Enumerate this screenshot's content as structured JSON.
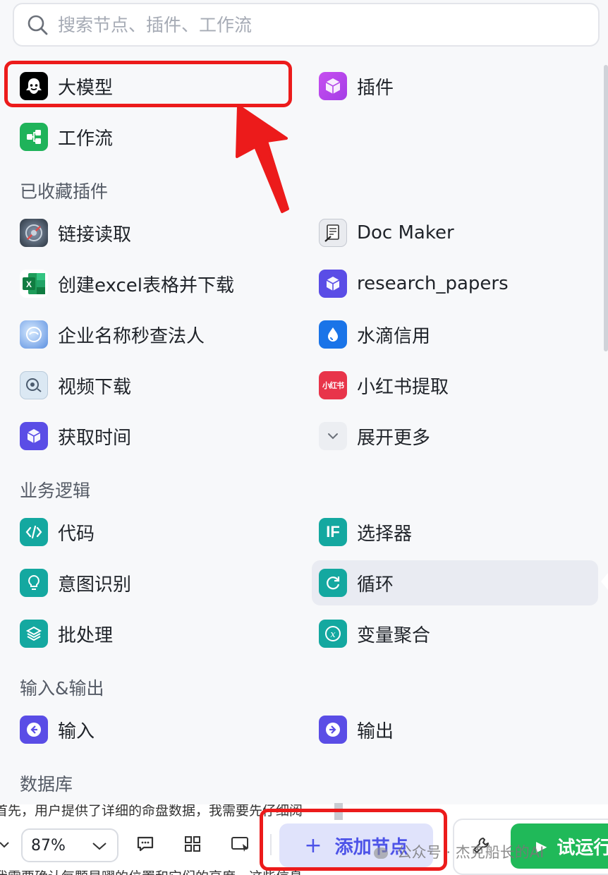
{
  "search": {
    "placeholder": "搜索节点、插件、工作流"
  },
  "top_items": [
    {
      "label": "大模型",
      "icon": "llm-icon"
    },
    {
      "label": "插件",
      "icon": "plugin-icon"
    },
    {
      "label": "工作流",
      "icon": "workflow-icon"
    }
  ],
  "sections": {
    "favorites": "已收藏插件",
    "logic": "业务逻辑",
    "io": "输入&输出",
    "database": "数据库"
  },
  "favorites": [
    {
      "label": "链接读取",
      "icon": "link-reader-icon"
    },
    {
      "label": "Doc Maker",
      "icon": "doc-maker-icon"
    },
    {
      "label": "创建excel表格并下载",
      "icon": "excel-icon"
    },
    {
      "label": "research_papers",
      "icon": "research-papers-icon"
    },
    {
      "label": "企业名称秒查法人",
      "icon": "enterprise-lookup-icon"
    },
    {
      "label": "水滴信用",
      "icon": "waterdrop-icon"
    },
    {
      "label": "视频下载",
      "icon": "video-download-icon"
    },
    {
      "label": "小红书提取",
      "icon": "xiaohongshu-icon",
      "icon_text": "小红书"
    },
    {
      "label": "获取时间",
      "icon": "time-icon"
    },
    {
      "label": "展开更多",
      "icon": "chevron-down-icon"
    }
  ],
  "logic": [
    {
      "label": "代码",
      "icon": "code-icon"
    },
    {
      "label": "选择器",
      "icon": "selector-icon",
      "icon_text": "IF"
    },
    {
      "label": "意图识别",
      "icon": "intent-icon"
    },
    {
      "label": "循环",
      "icon": "loop-icon"
    },
    {
      "label": "批处理",
      "icon": "batch-icon"
    },
    {
      "label": "变量聚合",
      "icon": "variable-merge-icon"
    }
  ],
  "io": [
    {
      "label": "输入",
      "icon": "input-icon"
    },
    {
      "label": "输出",
      "icon": "output-icon"
    }
  ],
  "background_text": {
    "line1": "首先，用户提供了详细的命盘数据，我需要先仔细阅",
    "line2": "我需要确认每颗星曜的位置和它们的亮度，这些信息"
  },
  "toolbar": {
    "zoom": "87%",
    "add_node": "添加节点",
    "test_run": "试运行"
  },
  "watermark": "公众号 · 杰克船长的AI"
}
